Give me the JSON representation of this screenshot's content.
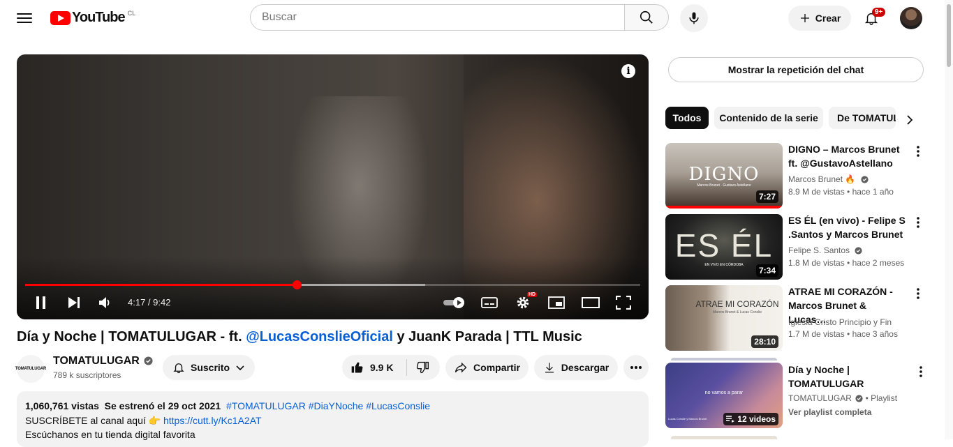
{
  "header": {
    "logo_text": "YouTube",
    "country": "CL",
    "search_placeholder": "Buscar",
    "create_label": "Crear",
    "notif_badge": "9+"
  },
  "player": {
    "time": "4:17 / 9:42",
    "progress_fraction": 0.442,
    "buffered_fraction": 0.65
  },
  "video": {
    "title_a": "Día y Noche | TOMATULUGAR - ft. ",
    "title_link": "@LucasConslieOficial",
    "title_b": " y JuanK Parada | TTL Music",
    "channel": "TOMATULUGAR",
    "channel_logo_text": "TOMATULUGAR",
    "subscribers": "789 k suscriptores",
    "subscribed_label": "Suscrito",
    "likes": "9.9 K",
    "share_label": "Compartir",
    "download_label": "Descargar"
  },
  "description": {
    "views": "1,060,761 vistas",
    "premiered": "Se estrenó el 29 oct 2021",
    "hashtags": "#TOMATULUGAR #DiaYNoche #LucasConslie",
    "line2_text": "SUSCRÍBETE al canal aquí 👉",
    "line2_link": "https://cutt.ly/Kc1A2AT",
    "line3": "Escúchanos en tu tienda digital favorita"
  },
  "sidebar": {
    "chat_replay": "Mostrar la repetición del chat",
    "chips": [
      "Todos",
      "Contenido de la serie",
      "De TOMATULUGAR"
    ],
    "items": [
      {
        "title": "DIGNO – Marcos Brunet ft. @GustavoAstellano",
        "channel": "Marcos Brunet 🔥",
        "meta": "8.9 M de vistas  • hace 1 año",
        "duration": "7:27",
        "thumb_text": "DIGNO",
        "thumb_sub": "Marcos Brunet · Gustavo Astellano"
      },
      {
        "title": "ES ÉL (en vivo) - Felipe S .Santos y Marcos Brunet",
        "channel": "Felipe S. Santos",
        "meta": "1.8 M de vistas  • hace 2 meses",
        "duration": "7:34",
        "thumb_text": "ES ÉL",
        "thumb_sub": "EN VIVO EN CÓRDOBA"
      },
      {
        "title": "ATRAE MI CORAZÓN - Marcos Brunet & Lucas…",
        "channel": "Iglesia Cristo Principio y Fin",
        "meta": "1.7 M de vistas  • hace 3 años",
        "duration": "28:10",
        "thumb_text": "ATRAE MI CORAZÓN",
        "thumb_sub": "Marcos Brunet & Lucas Conslie"
      },
      {
        "title": "Día y Noche | TOMATULUGAR",
        "channel": "TOMATULUGAR",
        "meta": "Playlist",
        "meta2": "Ver playlist completa",
        "duration": "12 videos",
        "thumb_text": "no vamos a parar",
        "thumb_sub": "Lucas Conslie y Marcos Brunet"
      }
    ]
  },
  "colors": {
    "accent": "#ff0000",
    "link": "#065fd4"
  }
}
